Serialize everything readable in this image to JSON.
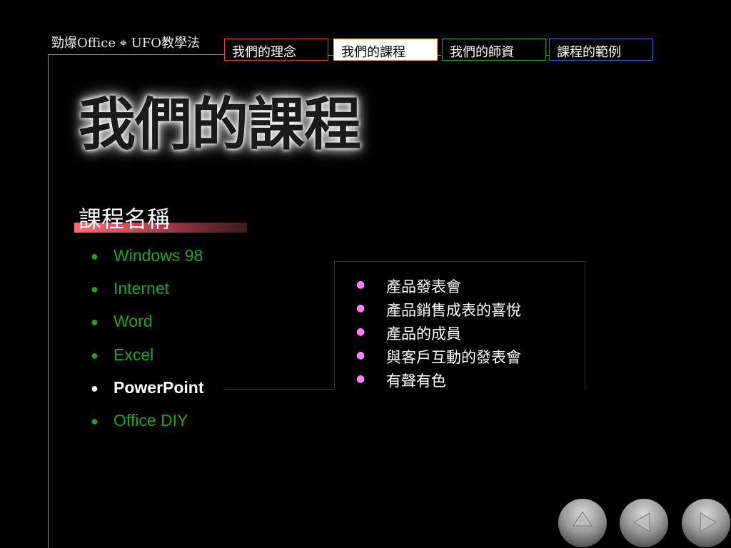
{
  "header": {
    "brand": "勁爆Office ⌖ UFO教學法"
  },
  "nav": {
    "tabs": [
      {
        "label": "我們的理念",
        "border": "#e04040",
        "active": false
      },
      {
        "label": "我們的課程",
        "border": "#e8b060",
        "active": true
      },
      {
        "label": "我們的師資",
        "border": "#30a030",
        "active": false
      },
      {
        "label": "課程的範例",
        "border": "#4060e0",
        "active": false
      }
    ]
  },
  "title": "我們的課程",
  "section_heading": "課程名稱",
  "courses": [
    {
      "label": "Windows 98",
      "active": false
    },
    {
      "label": "Internet",
      "active": false
    },
    {
      "label": "Word",
      "active": false
    },
    {
      "label": "Excel",
      "active": false
    },
    {
      "label": "PowerPoint",
      "active": true
    },
    {
      "label": "Office DIY",
      "active": false
    }
  ],
  "course_details": [
    "產品發表會",
    "產品銷售成表的喜悅",
    "產品的成員",
    "與客戶互動的發表會",
    "有聲有色"
  ],
  "bullet_glyph": "●",
  "colors": {
    "course_text": "#22a322",
    "detail_bullet": "#ff80ff",
    "heading_bar": "#ff6b75"
  },
  "nav_buttons": [
    "up-icon",
    "left-icon",
    "right-icon"
  ]
}
